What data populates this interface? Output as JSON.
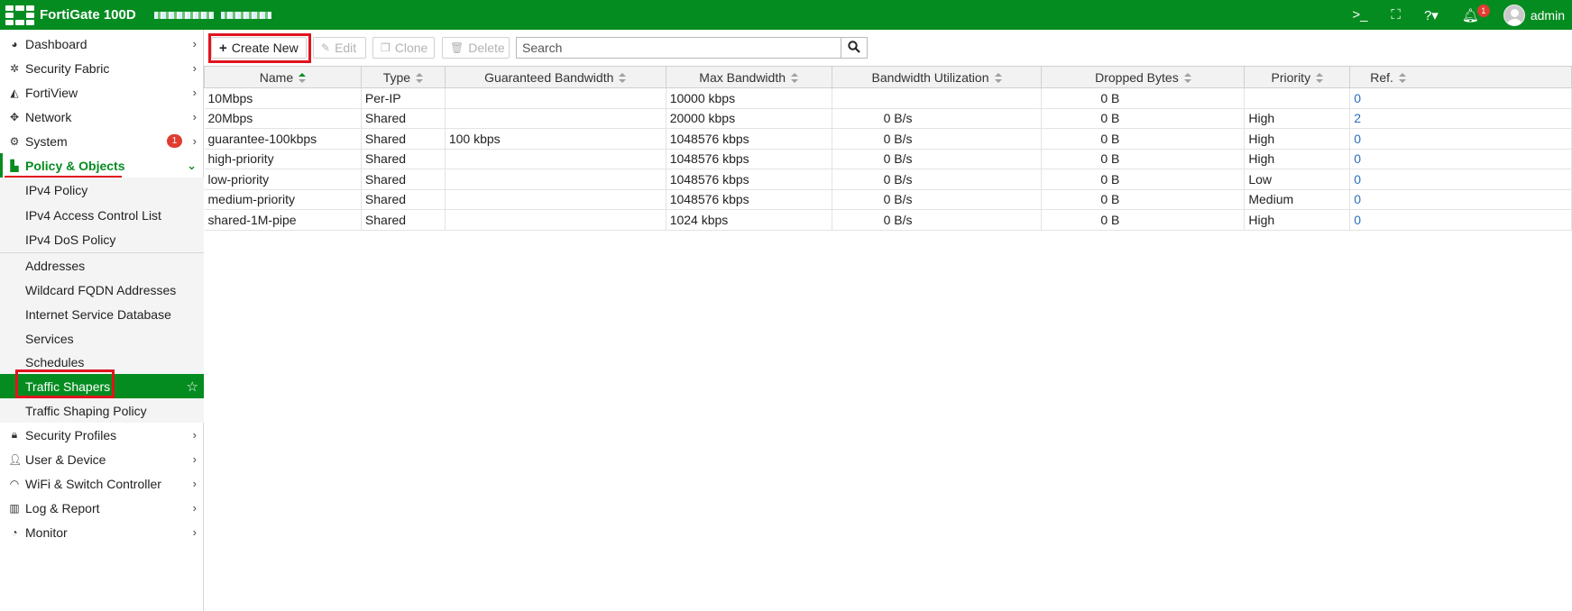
{
  "header": {
    "product": "FortiGate 100D",
    "notification_count": "1",
    "user": "admin",
    "icons": [
      "cli-console-icon",
      "fullscreen-icon",
      "help-icon",
      "bell-icon"
    ]
  },
  "sidebar": {
    "items": [
      {
        "label": "Dashboard",
        "icon": "dashboard-icon"
      },
      {
        "label": "Security Fabric",
        "icon": "security-fabric-icon"
      },
      {
        "label": "FortiView",
        "icon": "fortiview-icon"
      },
      {
        "label": "Network",
        "icon": "network-icon"
      },
      {
        "label": "System",
        "icon": "gear-icon",
        "badge": "1"
      },
      {
        "label": "Policy & Objects",
        "icon": "policy-icon"
      },
      {
        "label": "IPv4 Policy"
      },
      {
        "label": "IPv4 Access Control List"
      },
      {
        "label": "IPv4 DoS Policy"
      },
      {
        "label": "Addresses"
      },
      {
        "label": "Wildcard FQDN Addresses"
      },
      {
        "label": "Internet Service Database"
      },
      {
        "label": "Services"
      },
      {
        "label": "Schedules"
      },
      {
        "label": "Traffic Shapers"
      },
      {
        "label": "Traffic Shaping Policy"
      },
      {
        "label": "Security Profiles",
        "icon": "lock-icon"
      },
      {
        "label": "User & Device",
        "icon": "user-icon"
      },
      {
        "label": "WiFi & Switch Controller",
        "icon": "wifi-icon"
      },
      {
        "label": "Log & Report",
        "icon": "report-icon"
      },
      {
        "label": "Monitor",
        "icon": "monitor-icon"
      }
    ]
  },
  "toolbar": {
    "create_new": "Create New",
    "edit": "Edit",
    "clone": "Clone",
    "delete": "Delete",
    "search_placeholder": "Search"
  },
  "table": {
    "columns": [
      "Name",
      "Type",
      "Guaranteed Bandwidth",
      "Max Bandwidth",
      "Bandwidth Utilization",
      "Dropped Bytes",
      "Priority",
      "Ref."
    ],
    "rows": [
      [
        "10Mbps",
        "Per-IP",
        "",
        "10000 kbps",
        "",
        "0 B",
        "",
        "0"
      ],
      [
        "20Mbps",
        "Shared",
        "",
        "20000 kbps",
        "0 B/s",
        "0 B",
        "High",
        "2"
      ],
      [
        "guarantee-100kbps",
        "Shared",
        "100 kbps",
        "1048576 kbps",
        "0 B/s",
        "0 B",
        "High",
        "0"
      ],
      [
        "high-priority",
        "Shared",
        "",
        "1048576 kbps",
        "0 B/s",
        "0 B",
        "High",
        "0"
      ],
      [
        "low-priority",
        "Shared",
        "",
        "1048576 kbps",
        "0 B/s",
        "0 B",
        "Low",
        "0"
      ],
      [
        "medium-priority",
        "Shared",
        "",
        "1048576 kbps",
        "0 B/s",
        "0 B",
        "Medium",
        "0"
      ],
      [
        "shared-1M-pipe",
        "Shared",
        "",
        "1024 kbps",
        "0 B/s",
        "0 B",
        "High",
        "0"
      ]
    ]
  },
  "colors": {
    "brand_green": "#058c20",
    "highlight_red": "#e0141e",
    "link_blue": "#2a6fbd",
    "badge_red": "#e03c31"
  }
}
